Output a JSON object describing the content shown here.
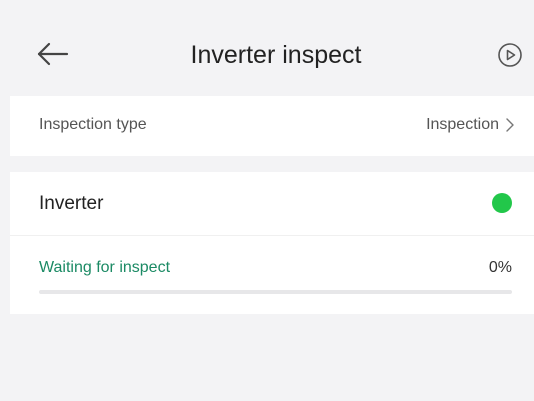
{
  "header": {
    "title": "Inverter inspect",
    "back_icon": "arrow-left-icon",
    "action_icon": "play-circle-icon"
  },
  "inspection_type": {
    "label": "Inspection type",
    "value": "Inspection"
  },
  "device": {
    "name": "Inverter",
    "status_color": "#22c74a",
    "status_text": "Waiting for inspect",
    "status_text_color": "#1b8a64",
    "progress_text": "0%",
    "progress": 0
  }
}
